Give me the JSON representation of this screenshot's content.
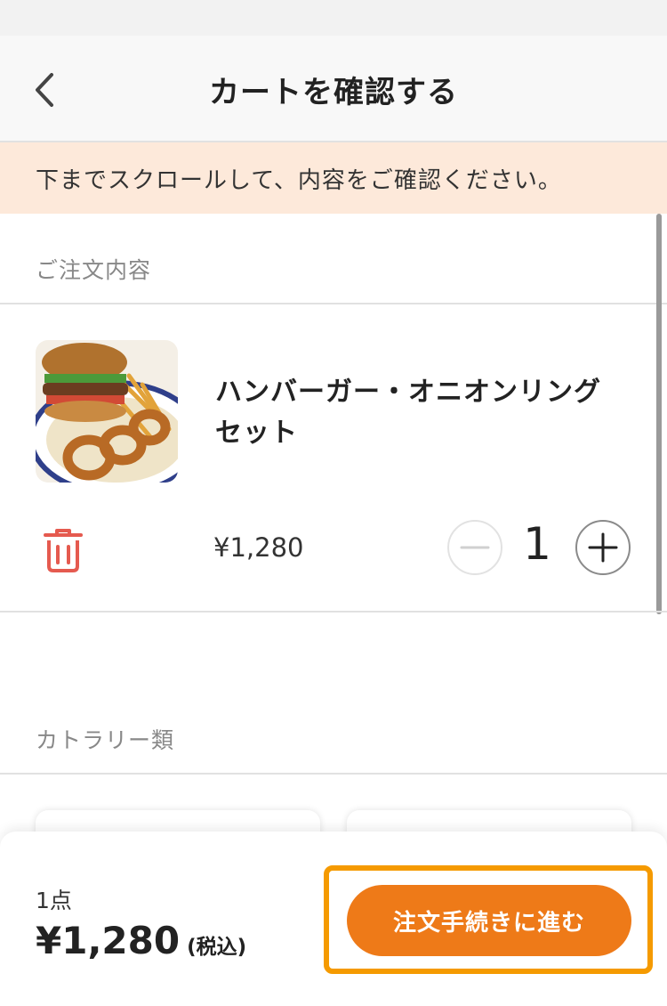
{
  "header": {
    "title": "カートを確認する"
  },
  "notice": {
    "text": "下までスクロールして、内容をご確認ください。"
  },
  "order_section": {
    "label": "ご注文内容",
    "items": [
      {
        "name": "ハンバーガー・オニオンリングセット",
        "price": "¥1,280",
        "quantity": "1"
      }
    ]
  },
  "cutlery_section": {
    "label": "カトラリー類"
  },
  "footer": {
    "count": "1点",
    "total": "¥1,280",
    "tax_note": "(税込)",
    "checkout_label": "注文手続きに進む"
  },
  "colors": {
    "accent": "#ee7a18",
    "highlight": "#f59a00",
    "notice_bg": "#fde9da",
    "trash": "#e55a4f"
  },
  "icons": [
    "back-chevron-icon",
    "trash-icon",
    "minus-icon",
    "plus-icon"
  ]
}
